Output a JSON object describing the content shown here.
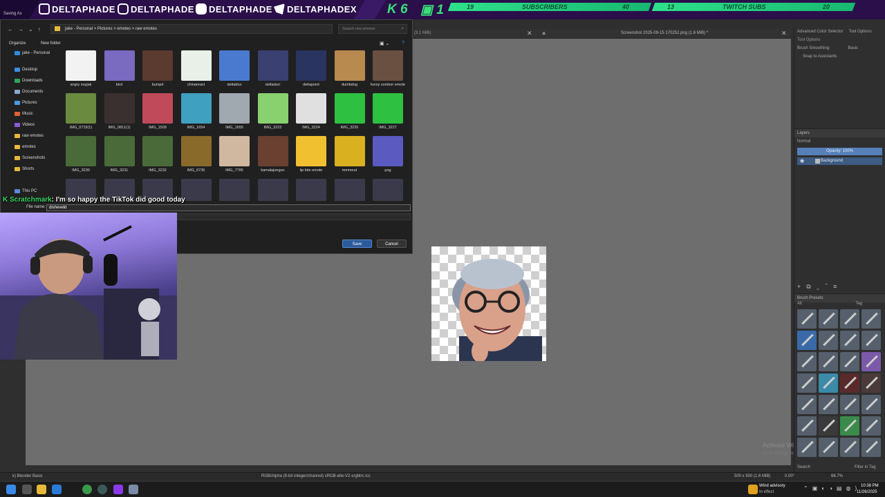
{
  "banner": {
    "socials": [
      "DELTAPHADE",
      "DELTAPHADE",
      "DELTAPHADE",
      "DELTAPHADEX"
    ],
    "k_value": "6",
    "twitch_value": "1",
    "subscribers": {
      "left": "19",
      "label": "SUBSCRIBERS",
      "right": "40"
    },
    "twitch_subs": {
      "left": "13",
      "label": "TWITCH SUBS",
      "right": "20"
    }
  },
  "dialog": {
    "title": "Saving As",
    "address": [
      "jake - Personal",
      "Pictures",
      "emotes",
      "raw emotes"
    ],
    "search_placeholder": "Search raw emotes",
    "organize_label": "Organize",
    "new_folder_label": "New folder",
    "nav": [
      {
        "label": "jake - Personal",
        "color": "#2e8be0"
      },
      {
        "label": "Desktop",
        "color": "#3a8fe0"
      },
      {
        "label": "Downloads",
        "color": "#2ea55c"
      },
      {
        "label": "Documents",
        "color": "#8aa8cc"
      },
      {
        "label": "Pictures",
        "color": "#4a9be8"
      },
      {
        "label": "Music",
        "color": "#e0603a"
      },
      {
        "label": "Videos",
        "color": "#8a5ad8"
      },
      {
        "label": "raw emotes",
        "color": "#e8b83a"
      },
      {
        "label": "emotes",
        "color": "#e8b83a"
      },
      {
        "label": "Screenshots",
        "color": "#e8b83a"
      },
      {
        "label": "Shorts",
        "color": "#e8b83a"
      },
      {
        "label": "This PC",
        "color": "#5a8ad8"
      }
    ],
    "files": [
      {
        "label": "angry soyjak",
        "color": "#f2f2f2"
      },
      {
        "label": "bird",
        "color": "#7a6ac0"
      },
      {
        "label": "bumpit",
        "color": "#5b3a30"
      },
      {
        "label": "chinareact",
        "color": "#e8f0e8"
      },
      {
        "label": "deltablur",
        "color": "#4a7ad0"
      },
      {
        "label": "deltadurr",
        "color": "#3a4070"
      },
      {
        "label": "deltapoint",
        "color": "#2a3460"
      },
      {
        "label": "dumbdog",
        "color": "#b88a50"
      },
      {
        "label": "funny somber emote",
        "color": "#6a5040"
      },
      {
        "label": "IMG_0719(1)",
        "color": "#6a8a40"
      },
      {
        "label": "IMG_0811(1)",
        "color": "#3a3030"
      },
      {
        "label": "IMG_1509",
        "color": "#c04a5a"
      },
      {
        "label": "IMG_1654",
        "color": "#40a0c0"
      },
      {
        "label": "IMG_1655",
        "color": "#a0a8b0"
      },
      {
        "label": "IMG_3223",
        "color": "#88d070"
      },
      {
        "label": "IMG_3224",
        "color": "#e0e0e0"
      },
      {
        "label": "IMG_3226",
        "color": "#2ec040"
      },
      {
        "label": "IMG_3227",
        "color": "#2ec040"
      },
      {
        "label": "IMG_3230",
        "color": "#4a6a3a"
      },
      {
        "label": "IMG_3231",
        "color": "#4a6a3a"
      },
      {
        "label": "IMG_3232",
        "color": "#4a6a3a"
      },
      {
        "label": "IMG_6735",
        "color": "#8a6a2a"
      },
      {
        "label": "IMG_7785",
        "color": "#d0b8a0"
      },
      {
        "label": "kamalajongun",
        "color": "#6a4030"
      },
      {
        "label": "lip bite emote",
        "color": "#f0c030"
      },
      {
        "label": "mmmnut",
        "color": "#d8b020"
      },
      {
        "label": "pog",
        "color": "#5a5ac0"
      }
    ],
    "filename_label": "File name:",
    "filename_value": "disheveld",
    "save_label": "Save",
    "cancel_label": "Cancel"
  },
  "chat": {
    "username": "Scratchmark",
    "message": ": I'm so happy the TikTok did good today"
  },
  "krita": {
    "tab_size": "(3.1 MiB)",
    "document_title": "Screenshot 2025-09-15 170252.png (1.6 MiB) *",
    "docker_tabs": [
      "Advanced Color Selector",
      "Tool Options"
    ],
    "tool_options_title": "Tool Options",
    "brush_smoothing_label": "Brush Smoothing:",
    "brush_smoothing_value": "Basic",
    "snap_label": "Snap to Assistants",
    "layers_title": "Layers",
    "blend_mode": "Normal",
    "opacity": "Opacity:  100%",
    "layer_name": "Background",
    "brush_presets_title": "Brush Presets",
    "brush_filter": "All",
    "tag_label": "Tag",
    "search_label": "Search",
    "filter_in_tag": "Filter in Tag",
    "status_brush": "k) Blender Basic",
    "status_color": "RGB/Alpha (8-bit integer/channel)  sRGB-elle-V2-srgbtrc.icc",
    "status_size": "500 x 500 (1.6 MiB)",
    "status_rotation": "0.00°",
    "status_zoom": "66.7%",
    "activate_windows": "Activate Windows",
    "activate_windows_sub": "Go to Settings to activate Windows."
  },
  "taskbar": {
    "weather_title": "Wind advisory",
    "weather_sub": "In effect",
    "time": "10:38 PM",
    "date": "11/26/2025"
  }
}
